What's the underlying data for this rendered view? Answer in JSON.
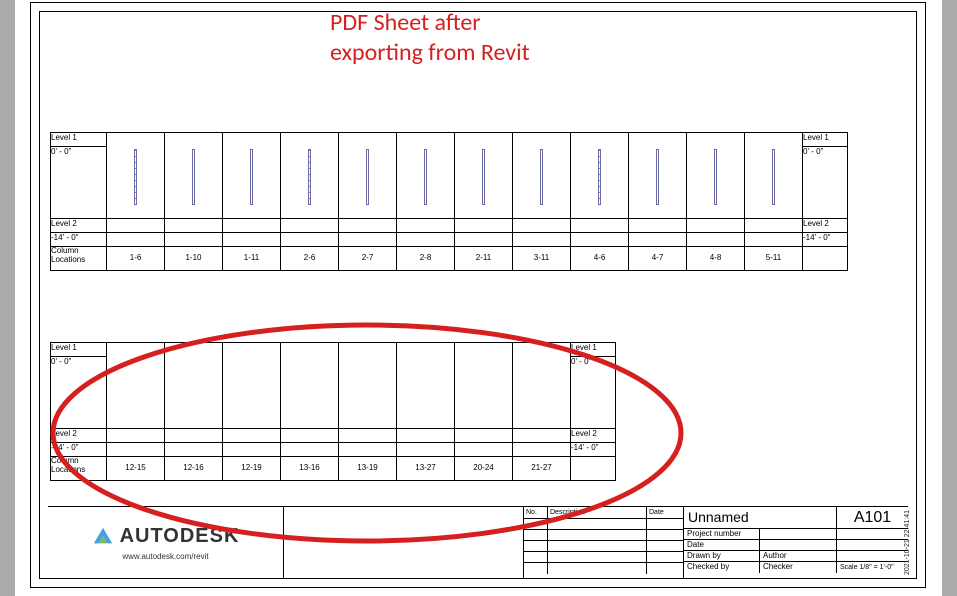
{
  "annotation": {
    "line1": "PDF Sheet after",
    "line2": "exporting from Revit"
  },
  "schedule1": {
    "level1_label": "Level 1",
    "level1_dim": "0' - 0\"",
    "level2_label": "Level 2",
    "level2_dim": "-14' - 0\"",
    "col_loc_label": "Column Locations",
    "columns": [
      "1-6",
      "1-10",
      "1-11",
      "2-6",
      "2-7",
      "2-8",
      "2-11",
      "3-11",
      "4-6",
      "4-7",
      "4-8",
      "5-11"
    ]
  },
  "schedule2": {
    "level1_label": "Level 1",
    "level1_dim": "0' - 0\"",
    "level2_label": "Level 2",
    "level2_dim": "-14' - 0\"",
    "col_loc_label": "Column Locations",
    "columns": [
      "12-15",
      "12-16",
      "12-19",
      "13-16",
      "13-19",
      "13-27",
      "20-24",
      "21-27"
    ]
  },
  "titleblock": {
    "brand": "AUTODESK",
    "url": "www.autodesk.com/revit",
    "rev_head_no": "No.",
    "rev_head_desc": "Description",
    "rev_head_date": "Date",
    "project_name": "Unnamed",
    "sheet_no": "A101",
    "rows": {
      "pn_label": "Project number",
      "pn_value": "",
      "date_label": "Date",
      "date_value": "",
      "drawn_label": "Drawn by",
      "drawn_value": "Author",
      "checked_label": "Checked by",
      "checked_value": "Checker",
      "scale_label": "Scale",
      "scale_value": "1/8\" = 1'-0\""
    }
  },
  "side_stamp": "2021-10-21 22:41:41"
}
